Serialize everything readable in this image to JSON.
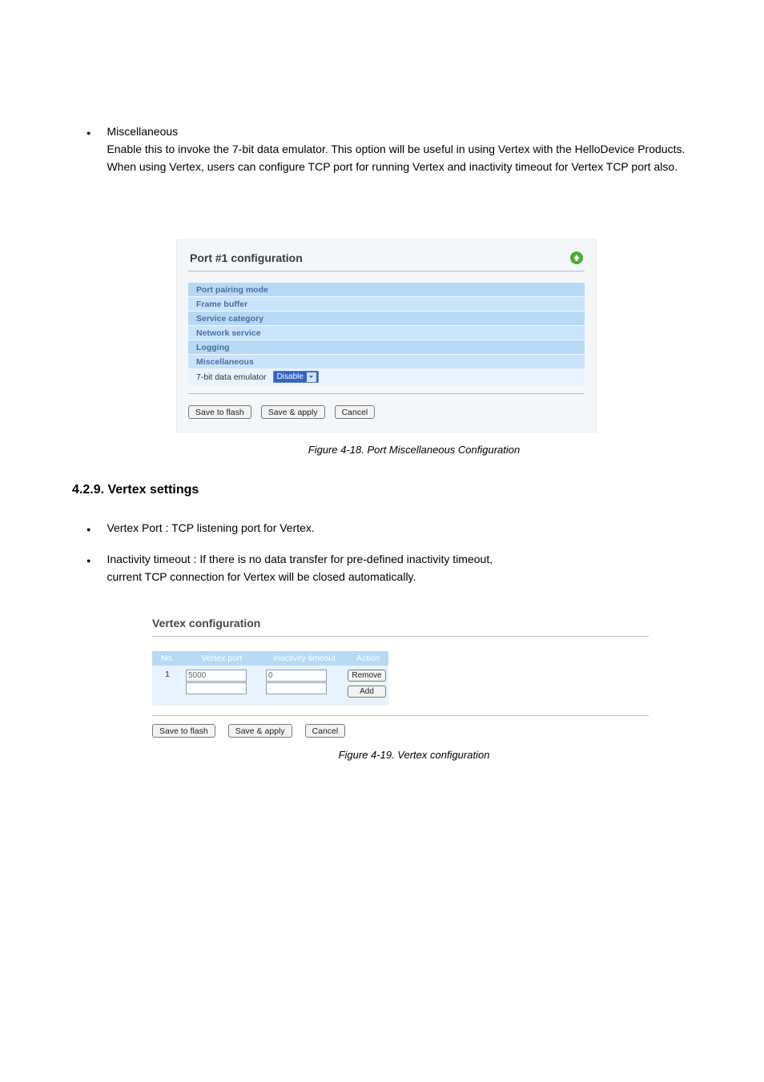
{
  "bullets": {
    "misc": {
      "title": "Miscellaneous",
      "text": "Enable this to invoke the 7-bit data emulator. This option will be useful in using Vertex with the HelloDevice Products. When using Vertex, users can configure TCP port for running Vertex and inactivity timeout for Vertex TCP port also."
    },
    "vertex_port": {
      "title": "Vertex Port : TCP listening port for Vertex."
    },
    "inactivity": {
      "title": "Inactivity timeout : If there is no data transfer for pre-defined inactivity timeout,",
      "text": "current TCP connection for Vertex will be closed automatically."
    }
  },
  "panel1": {
    "title": "Port #1 configuration",
    "sections": [
      "Port pairing mode",
      "Frame buffer",
      "Service category",
      "Network service",
      "Logging",
      "Miscellaneous"
    ],
    "config_label": "7-bit data emulator",
    "select_value": "Disable",
    "buttons": {
      "save_flash": "Save to flash",
      "save_apply": "Save & apply",
      "cancel": "Cancel"
    }
  },
  "fig1_caption": "Figure 4-18. Port Miscellaneous Configuration",
  "section_heading": "4.2.9. Vertex settings",
  "panel2": {
    "title": "Vertex configuration",
    "headers": {
      "no": "No.",
      "port": "Vertex port",
      "timeout": "Inactivity timeout",
      "action": "Action"
    },
    "rows": [
      {
        "no": "1",
        "port": "5000",
        "timeout": "0",
        "action": "Remove"
      }
    ],
    "add_row": {
      "port": "",
      "timeout": "",
      "action": "Add"
    },
    "buttons": {
      "save_flash": "Save to flash",
      "save_apply": "Save & apply",
      "cancel": "Cancel"
    }
  },
  "fig2_caption": "Figure 4-19. Vertex configuration"
}
